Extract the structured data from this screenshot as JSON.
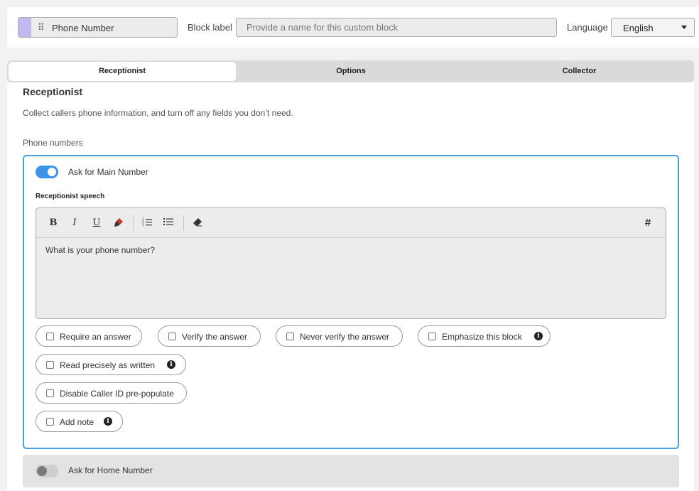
{
  "header": {
    "block_name": "Phone Number",
    "block_label_caption": "Block label",
    "block_label_value": "",
    "block_label_placeholder": "Provide a name for this custom block",
    "language_caption": "Language",
    "language_value": "English"
  },
  "tabs": [
    {
      "label": "Receptionist",
      "active": true
    },
    {
      "label": "Options",
      "active": false
    },
    {
      "label": "Collector",
      "active": false
    }
  ],
  "section": {
    "title": "Receptionist",
    "description": "Collect callers phone information, and turn off any fields you don’t need.",
    "sub_heading": "Phone numbers"
  },
  "main_number": {
    "toggle_label": "Ask for Main Number",
    "toggle_on": true,
    "speech_label": "Receptionist speech",
    "speech_text": "What is your phone number?",
    "toolbar_icons": [
      "bold-icon",
      "italic-icon",
      "underline-icon",
      "highlight-icon",
      "ordered-list-icon",
      "bullet-list-icon",
      "eraser-icon",
      "hash-icon"
    ],
    "options": [
      {
        "label": "Require an answer",
        "checked": false,
        "info": false
      },
      {
        "label": "Verify the answer",
        "checked": false,
        "info": false
      },
      {
        "label": "Never verify the answer",
        "checked": false,
        "info": false
      },
      {
        "label": "Emphasize this block",
        "checked": false,
        "info": true
      },
      {
        "label": "Read precisely as written",
        "checked": false,
        "info": true
      },
      {
        "label": "Disable Caller ID pre-populate",
        "checked": false,
        "info": false
      },
      {
        "label": "Add note",
        "checked": false,
        "info": true
      }
    ]
  },
  "home_number": {
    "toggle_label": "Ask for Home Number",
    "toggle_on": false
  },
  "colors": {
    "accent": "#3c93e8",
    "block_stripe": "#c4b9ee",
    "card_border": "#46a0e8"
  }
}
